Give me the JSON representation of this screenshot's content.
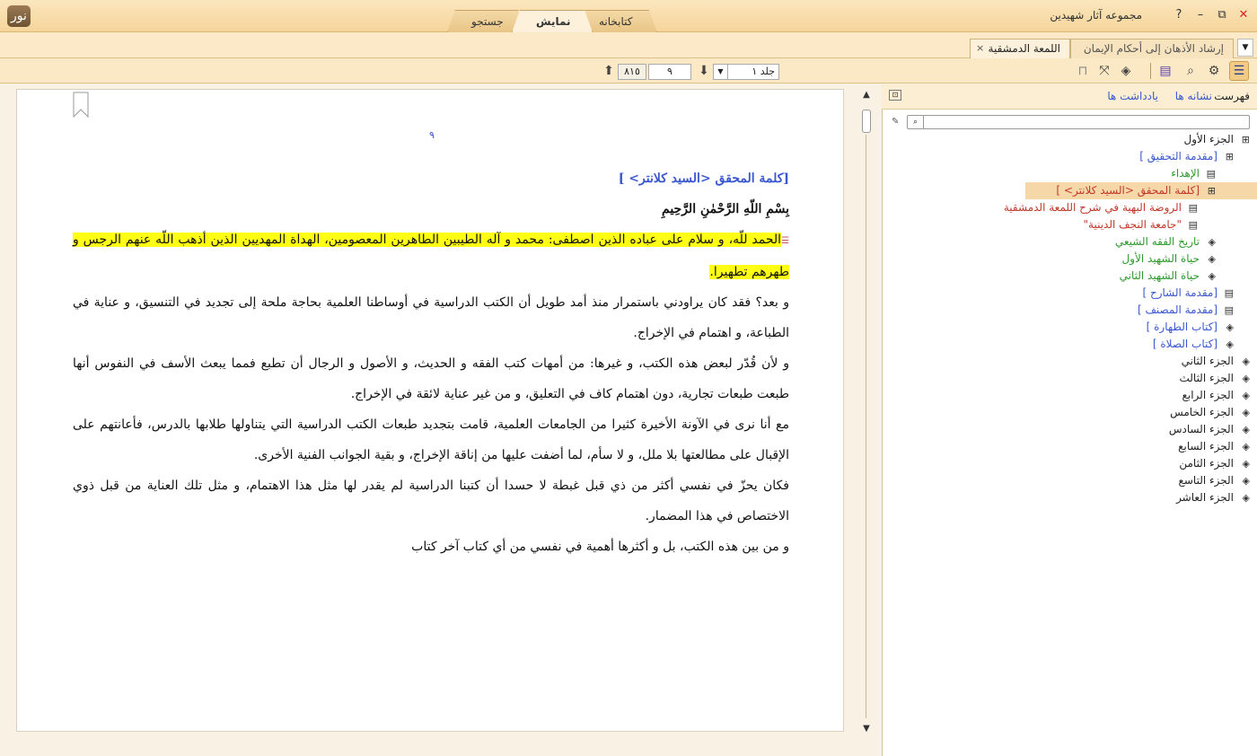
{
  "window": {
    "title": "مجموعه آثار شهیدین",
    "logo": "نور",
    "help": "?",
    "minimize": "–",
    "restore": "⧉",
    "close": "✕"
  },
  "main_tabs": {
    "library": "کتابخانه",
    "display": "نمایش",
    "search": "جستجو"
  },
  "doc_tabs": {
    "irshad": "إرشاد الأذهان إلى أحكام الإيمان",
    "lumaa": "اللمعة الدمشقية",
    "close": "×",
    "dropdown": "▼"
  },
  "toolbar": {
    "volume": "جلد ١",
    "page": "٩",
    "total_pages": "٨١٥",
    "dropdown": "▼",
    "page_down": "⬇",
    "page_up": "⬆"
  },
  "reader": {
    "page_number": "٩",
    "section_heading": "[كلمة المحقق <السيد كلانتر> ]",
    "basmala": "بِسْمِ اللّهِ الرَّحْمٰنِ الرَّحِيمِ",
    "highlighted_paragraph": "الحمد للّه، و سلام على عباده الذين اصطفى: محمد و آله الطيبين الطاهرين المعصومين، الهداة المهديين الذين أذهب اللّه عنهم الرجس و طهرهم تطهيرا.",
    "paragraphs": [
      "و بعد؟ فقد كان يراودني باستمرار منذ أمد طويل أن الكتب الدراسية في أوساطنا العلمية بحاجة ملحة إلى تجديد في التنسيق، و عناية في الطباعة، و اهتمام في الإخراج.",
      "و لأن قُدّر لبعض هذه الكتب، و غيرها: من أمهات كتب الفقه و الحديث، و الأصول و الرجال أن تطبع فمما يبعث الأسف في النفوس أنها طبعت طبعات تجارية، دون اهتمام كاف في التعليق، و من غير عناية لائقة في الإخراج.",
      "مع أنا نرى في الآونة الأخيرة كثيرا من الجامعات العلمية، قامت بتجديد طبعات الكتب الدراسية التي يتناولها طلابها بالدرس، فأعانتهم على الإقبال على مطالعتها بلا ملل، و لا سأم، لما أضفت عليها من إناقة الإخراج، و بقية الجوانب الفنية الأخرى.",
      "فكان يحزّ في نفسي أكثر من ذي قبل غبطة لا حسدا أن كتبنا الدراسية لم يقدر لها مثل هذا الاهتمام، و مثل تلك العناية من قبل ذوي الاختصاص في هذا المضمار.",
      "و من بين هذه الكتب، بل و أكثرها أهمية في نفسي من أي كتاب آخر كتاب"
    ]
  },
  "sidebar": {
    "tabs": {
      "index": "فهرست",
      "bookmarks": "نشانه ها",
      "notes": "یادداشت ها"
    },
    "search_placeholder": "",
    "toc": [
      {
        "label": "الجزء الأول",
        "level": 0,
        "color": "dark",
        "icon": "open-book"
      },
      {
        "label": "[مقدمة التحقيق ]",
        "level": 1,
        "color": "blue",
        "icon": "open-book"
      },
      {
        "label": "الإهداء",
        "level": 2,
        "color": "green",
        "icon": "page"
      },
      {
        "label": "[كلمة المحقق <السيد كلانتر> ]",
        "level": 2,
        "color": "red",
        "icon": "open-book",
        "selected": true
      },
      {
        "label": "الروضة البهية في شرح اللمعة الدمشقية",
        "level": 3,
        "color": "red",
        "icon": "page"
      },
      {
        "label": "\"جامعة النجف الدينية\"",
        "level": 3,
        "color": "red",
        "icon": "page"
      },
      {
        "label": "تاريخ الفقه الشيعي",
        "level": 2,
        "color": "green",
        "icon": "closed-book"
      },
      {
        "label": "حياة الشهيد الأول",
        "level": 2,
        "color": "green",
        "icon": "closed-book"
      },
      {
        "label": "حياة الشهيد الثاني",
        "level": 2,
        "color": "green",
        "icon": "closed-book"
      },
      {
        "label": "[مقدمة الشارح ]",
        "level": 1,
        "color": "blue",
        "icon": "page"
      },
      {
        "label": "[مقدمة المصنف ]",
        "level": 1,
        "color": "blue",
        "icon": "page"
      },
      {
        "label": "[كتاب الطهارة ]",
        "level": 1,
        "color": "blue",
        "icon": "closed-book"
      },
      {
        "label": "[كتاب الصلاة ]",
        "level": 1,
        "color": "blue",
        "icon": "closed-book"
      },
      {
        "label": "الجزء الثاني",
        "level": 0,
        "color": "dark",
        "icon": "closed-book"
      },
      {
        "label": "الجزء الثالث",
        "level": 0,
        "color": "dark",
        "icon": "closed-book"
      },
      {
        "label": "الجزء الرابع",
        "level": 0,
        "color": "dark",
        "icon": "closed-book"
      },
      {
        "label": "الجزء الخامس",
        "level": 0,
        "color": "dark",
        "icon": "closed-book"
      },
      {
        "label": "الجزء السادس",
        "level": 0,
        "color": "dark",
        "icon": "closed-book"
      },
      {
        "label": "الجزء السابع",
        "level": 0,
        "color": "dark",
        "icon": "closed-book"
      },
      {
        "label": "الجزء الثامن",
        "level": 0,
        "color": "dark",
        "icon": "closed-book"
      },
      {
        "label": "الجزء التاسع",
        "level": 0,
        "color": "dark",
        "icon": "closed-book"
      },
      {
        "label": "الجزء العاشر",
        "level": 0,
        "color": "dark",
        "icon": "closed-book"
      }
    ]
  },
  "colors": {
    "accent": "#f5d59b",
    "link_blue": "#3a57d0",
    "highlight": "#ffff16",
    "selected_row": "#f6d8a8"
  }
}
